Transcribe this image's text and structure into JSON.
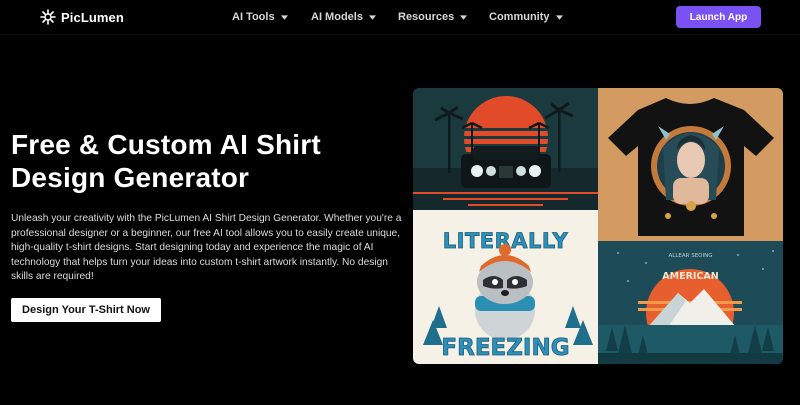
{
  "brand": {
    "name": "PicLumen",
    "icon": "sparkle-logo-icon",
    "accent": "#7a52f4"
  },
  "nav": {
    "items": [
      {
        "label": "AI Tools"
      },
      {
        "label": "AI Models"
      },
      {
        "label": "Resources"
      },
      {
        "label": "Community"
      }
    ],
    "launch_label": "Launch App"
  },
  "hero": {
    "title": "Free & Custom AI Shirt Design Generator",
    "description": "Unleash your creativity with the PicLumen AI Shirt Design Generator. Whether you're a professional designer or a beginner, our free AI tool allows you to easily create unique, high-quality t-shirt designs. Start designing today and experience the magic of AI technology that helps turn your ideas into custom t-shirt artwork instantly. No design skills are required!",
    "cta_label": "Design Your T-Shirt Now"
  },
  "collage": {
    "images": [
      {
        "subject": "retro-car-sunset-art"
      },
      {
        "subject": "black-tshirt-woman-portrait"
      },
      {
        "subject": "raccoon-literally-freezing",
        "text_top": "LITERALLY",
        "text_bottom": "FREEZING"
      },
      {
        "subject": "mountain-sunset-american",
        "text_top": "ALLEAR SEOING",
        "text_main": "AMERICAN"
      }
    ]
  }
}
